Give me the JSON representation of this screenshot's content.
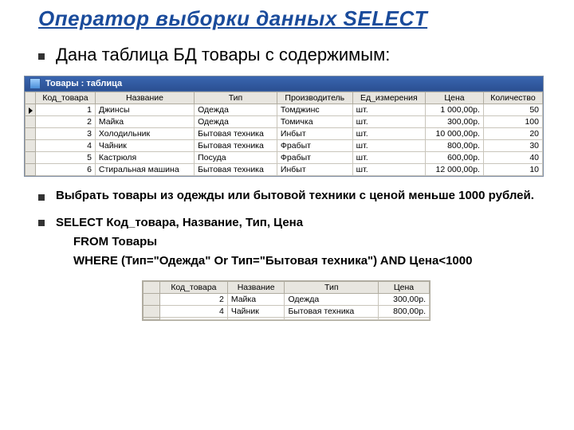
{
  "title": "Оператор выборки данных SELECT",
  "intro": "Дана таблица БД товары с содержимым:",
  "window_title": "Товары : таблица",
  "main_table": {
    "headers": [
      "Код_товара",
      "Название",
      "Тип",
      "Производитель",
      "Ед_измерения",
      "Цена",
      "Количество"
    ],
    "rows": [
      {
        "id": "1",
        "name": "Джинсы",
        "type": "Одежда",
        "mfr": "Томджинс",
        "unit": "шт.",
        "price": "1 000,00р.",
        "qty": "50"
      },
      {
        "id": "2",
        "name": "Майка",
        "type": "Одежда",
        "mfr": "Томичка",
        "unit": "шт.",
        "price": "300,00р.",
        "qty": "100"
      },
      {
        "id": "3",
        "name": "Холодильник",
        "type": "Бытовая техника",
        "mfr": "Инбыт",
        "unit": "шт.",
        "price": "10 000,00р.",
        "qty": "20"
      },
      {
        "id": "4",
        "name": "Чайник",
        "type": "Бытовая техника",
        "mfr": "Фрабыт",
        "unit": "шт.",
        "price": "800,00р.",
        "qty": "30"
      },
      {
        "id": "5",
        "name": "Кастрюля",
        "type": "Посуда",
        "mfr": "Фрабыт",
        "unit": "шт.",
        "price": "600,00р.",
        "qty": "40"
      },
      {
        "id": "6",
        "name": "Стиральная машина",
        "type": "Бытовая техника",
        "mfr": "Инбыт",
        "unit": "шт.",
        "price": "12 000,00р.",
        "qty": "10"
      }
    ]
  },
  "task": "Выбрать товары из одежды или бытовой техники с ценой меньше 1000 рублей.",
  "sql": {
    "line1": "SELECT Код_товара, Название, Тип, Цена",
    "line2": "FROM Товары",
    "line3": "WHERE (Тип=\"Одежда\" Or Тип=\"Бытовая техника\") AND Цена<1000"
  },
  "result_table": {
    "headers": [
      "Код_товара",
      "Название",
      "Тип",
      "Цена"
    ],
    "rows": [
      {
        "id": "2",
        "name": "Майка",
        "type": "Одежда",
        "price": "300,00р."
      },
      {
        "id": "4",
        "name": "Чайник",
        "type": "Бытовая техника",
        "price": "800,00р."
      }
    ]
  }
}
